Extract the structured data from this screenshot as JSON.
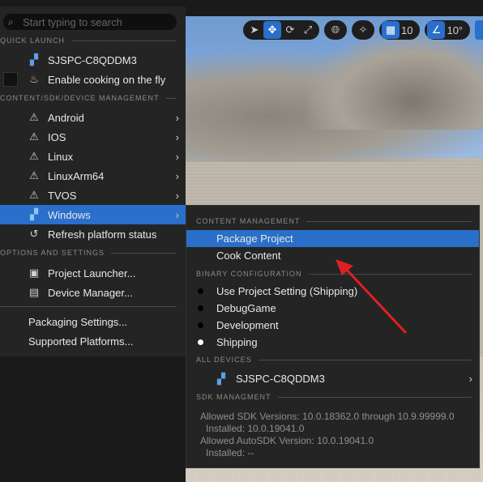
{
  "search": {
    "placeholder": "Start typing to search"
  },
  "sections": {
    "quick_launch": "QUICK LAUNCH",
    "content_sdk": "CONTENT/SDK/DEVICE MANAGEMENT",
    "options": "OPTIONS AND SETTINGS"
  },
  "quick_launch": {
    "device": "SJSPC-C8QDDM3",
    "cooking": "Enable cooking on the fly"
  },
  "platforms": [
    {
      "label": "Android",
      "icon": "warning-icon"
    },
    {
      "label": "IOS",
      "icon": "warning-icon"
    },
    {
      "label": "Linux",
      "icon": "warning-icon"
    },
    {
      "label": "LinuxArm64",
      "icon": "warning-icon"
    },
    {
      "label": "TVOS",
      "icon": "warning-icon"
    },
    {
      "label": "Windows",
      "icon": "windows-icon"
    }
  ],
  "refresh": "Refresh platform status",
  "options": {
    "launcher": "Project Launcher...",
    "device_manager": "Device Manager...",
    "packaging": "Packaging Settings...",
    "supported": "Supported Platforms..."
  },
  "submenu": {
    "content_mgmt": "CONTENT MANAGEMENT",
    "package_project": "Package Project",
    "cook_content": "Cook Content",
    "binary_config": "BINARY CONFIGURATION",
    "configs": [
      {
        "label": "Use Project Setting (Shipping)",
        "selected": false
      },
      {
        "label": "DebugGame",
        "selected": false
      },
      {
        "label": "Development",
        "selected": false
      },
      {
        "label": "Shipping",
        "selected": true
      }
    ],
    "all_devices": "ALL DEVICES",
    "device": "SJSPC-C8QDDM3",
    "sdk_mgmt": "SDK MANAGMENT",
    "sdk_lines": [
      "Allowed SDK Versions: 10.0.18362.0 through 10.9.99999.0",
      "Installed: 10.0.19041.0",
      "Allowed AutoSDK Version: 10.0.19041.0",
      "Installed: --"
    ]
  },
  "toolbar": {
    "grid_value": "10",
    "angle_value": "10°"
  },
  "colors": {
    "accent": "#2a6fc9",
    "annotation_arrow": "#e02020"
  }
}
